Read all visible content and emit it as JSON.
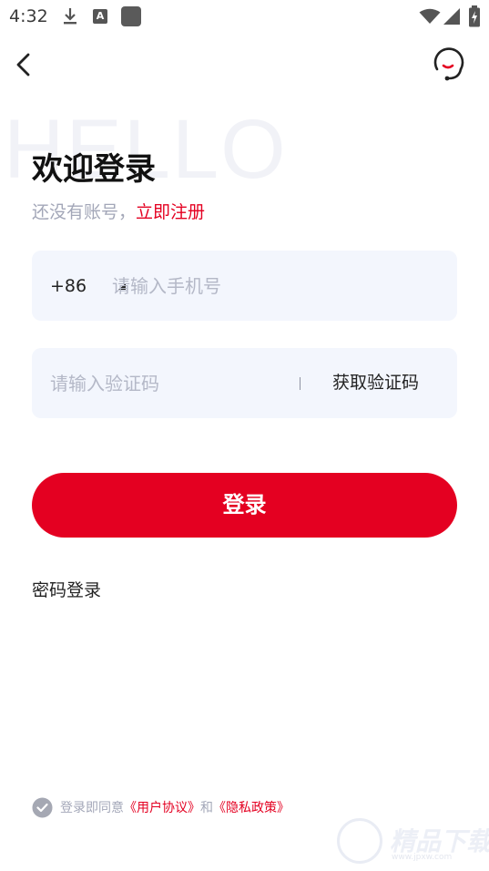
{
  "status_bar": {
    "time": "4:32",
    "icons": [
      "download-icon",
      "a-notification-icon",
      "app-square-icon",
      "wifi-icon",
      "signal-icon",
      "battery-charging-icon"
    ]
  },
  "header": {
    "back_icon": "chevron-left-icon",
    "support_icon": "customer-service-headset-icon"
  },
  "watermark_text": "HELLO",
  "title": "欢迎登录",
  "register": {
    "hint": "还没有账号，",
    "link": "立即注册"
  },
  "phone": {
    "country_code": "+86",
    "placeholder": "请输入手机号",
    "value": ""
  },
  "code": {
    "placeholder": "请输入验证码",
    "value": "",
    "get_code_label": "获取验证码"
  },
  "login_button": "登录",
  "password_login": "密码登录",
  "agreement": {
    "prefix": "登录即同意",
    "user_agreement": "《用户协议》",
    "conjunction": "和",
    "privacy_policy": "《隐私政策》",
    "checked": true
  },
  "site_watermark": {
    "name": "精品下载",
    "url": "www.jpxw.com"
  },
  "colors": {
    "accent": "#e40021",
    "field_bg": "#f3f6fd",
    "hint": "#a3a7b8"
  }
}
